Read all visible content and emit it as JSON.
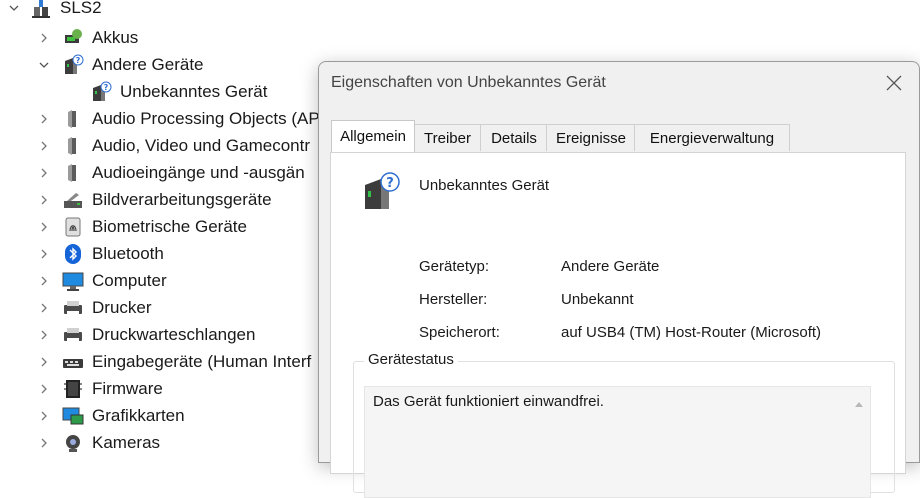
{
  "tree": {
    "root": {
      "label": "SLS2",
      "icon": "computer-icon"
    },
    "items": [
      {
        "label": "Akkus",
        "icon": "battery-icon",
        "expanded": false
      },
      {
        "label": "Andere Geräte",
        "icon": "unknown-device-icon",
        "expanded": true
      },
      {
        "label": "Unbekanntes Gerät",
        "icon": "unknown-device-icon",
        "child": true
      },
      {
        "label": "Audio Processing Objects (AP",
        "icon": "speaker-icon",
        "expanded": false
      },
      {
        "label": "Audio, Video und Gamecontr",
        "icon": "speaker-icon",
        "expanded": false
      },
      {
        "label": "Audioeingänge und -ausgän",
        "icon": "speaker-icon",
        "expanded": false
      },
      {
        "label": "Bildverarbeitungsgeräte",
        "icon": "camera-device-icon",
        "expanded": false
      },
      {
        "label": "Biometrische Geräte",
        "icon": "fingerprint-icon",
        "expanded": false
      },
      {
        "label": "Bluetooth",
        "icon": "bluetooth-icon",
        "expanded": false
      },
      {
        "label": "Computer",
        "icon": "monitor-icon",
        "expanded": false
      },
      {
        "label": "Drucker",
        "icon": "printer-icon",
        "expanded": false
      },
      {
        "label": "Druckwarteschlangen",
        "icon": "printer-icon",
        "expanded": false
      },
      {
        "label": "Eingabegeräte (Human Interf",
        "icon": "keyboard-icon",
        "expanded": false
      },
      {
        "label": "Firmware",
        "icon": "firmware-icon",
        "expanded": false
      },
      {
        "label": "Grafikkarten",
        "icon": "display-adapter-icon",
        "expanded": false
      },
      {
        "label": "Kameras",
        "icon": "webcam-icon",
        "expanded": false
      }
    ]
  },
  "dialog": {
    "title": "Eigenschaften von Unbekanntes Gerät",
    "tabs": [
      "Allgemein",
      "Treiber",
      "Details",
      "Ereignisse",
      "Energieverwaltung"
    ],
    "active_tab": "Allgemein",
    "device_name": "Unbekanntes Gerät",
    "properties": [
      {
        "label": "Gerätetyp:",
        "value": "Andere Geräte"
      },
      {
        "label": "Hersteller:",
        "value": "Unbekannt"
      },
      {
        "label": "Speicherort:",
        "value": "auf USB4 (TM) Host-Router (Microsoft)"
      }
    ],
    "status_group_title": "Gerätestatus",
    "status_text": "Das Gerät funktioniert einwandfrei."
  },
  "colors": {
    "accent": "#1a73e8",
    "dialog_bg": "#f0f0f0"
  }
}
